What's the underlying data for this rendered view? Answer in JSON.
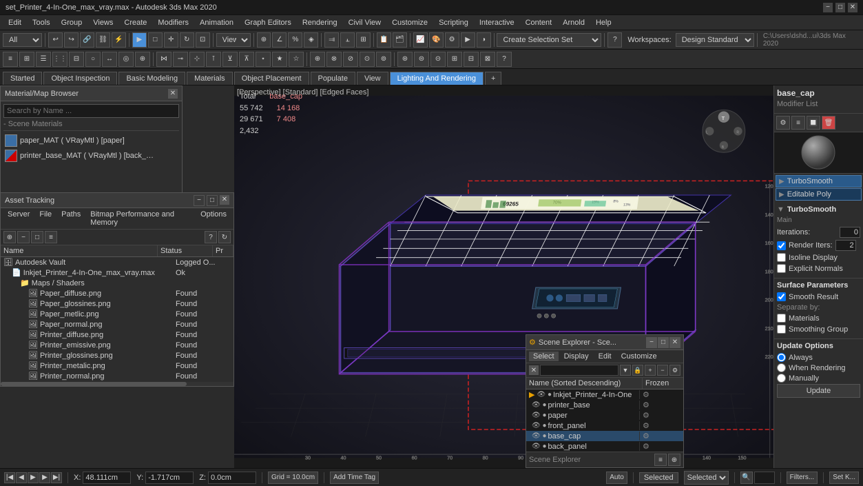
{
  "titlebar": {
    "title": "set_Printer_4-In-One_max_vray.max - Autodesk 3ds Max 2020",
    "min": "−",
    "max": "□",
    "close": "✕"
  },
  "menubar": {
    "items": [
      "Edit",
      "Tools",
      "Group",
      "Views",
      "Create",
      "Modifiers",
      "Animation",
      "Graph Editors",
      "Rendering",
      "Civil View",
      "Customize",
      "Scripting",
      "Interactive",
      "Content",
      "Arnold",
      "Help"
    ]
  },
  "toolbar": {
    "view_label": "All",
    "view_dropdown": "View",
    "workspace_label": "Workspaces:",
    "workspace_value": "Design Standard",
    "path": "C:\\Users\\dshd...ui\\3ds Max 2020"
  },
  "tabs": {
    "items": [
      "Started",
      "Object Inspection",
      "Basic Modeling",
      "Materials",
      "Object Placement",
      "Populate",
      "View",
      "Lighting And Rendering"
    ],
    "active": "Lighting And Rendering",
    "plus": "+"
  },
  "viewport": {
    "mode_label": "[Perspective] [Standard] [Edged Faces]",
    "stats": {
      "total_label": "Total",
      "total_obj": "base_cap",
      "v1": "55 742",
      "v2": "14 168",
      "v3": "29 671",
      "v4": "7 408",
      "v5": "2,432"
    }
  },
  "mat_browser": {
    "title": "Material/Map Browser",
    "search_placeholder": "Search by Name ...",
    "section_label": "Scene Materials",
    "items": [
      {
        "name": "paper_MAT (VRayMtl) [paper]",
        "type": "blue"
      },
      {
        "name": "printer_base_MAT (VRayMtl) [back_panel, ba...",
        "type": "blue-stripe"
      }
    ]
  },
  "asset_tracking": {
    "title": "Asset Tracking",
    "menu_items": [
      "Server",
      "File",
      "Paths",
      "Bitmap Performance and Memory",
      "Options"
    ],
    "columns": [
      "Name",
      "Status",
      "Pr"
    ],
    "rows": [
      {
        "indent": 0,
        "icon": "📁",
        "name": "Autodesk Vault",
        "status": "Logged O...",
        "pr": ""
      },
      {
        "indent": 1,
        "icon": "📄",
        "name": "Inkjet_Printer_4-In-One_max_vray.max",
        "status": "Ok",
        "pr": ""
      },
      {
        "indent": 2,
        "icon": "📁",
        "name": "Maps / Shaders",
        "status": "",
        "pr": ""
      },
      {
        "indent": 3,
        "icon": "🖼",
        "name": "Paper_diffuse.png",
        "status": "Found",
        "pr": ""
      },
      {
        "indent": 3,
        "icon": "🖼",
        "name": "Paper_glossines.png",
        "status": "Found",
        "pr": ""
      },
      {
        "indent": 3,
        "icon": "🖼",
        "name": "Paper_metlic.png",
        "status": "Found",
        "pr": ""
      },
      {
        "indent": 3,
        "icon": "🖼",
        "name": "Paper_normal.png",
        "status": "Found",
        "pr": ""
      },
      {
        "indent": 3,
        "icon": "🖼",
        "name": "Printer_diffuse.png",
        "status": "Found",
        "pr": ""
      },
      {
        "indent": 3,
        "icon": "🖼",
        "name": "Printer_emissive.png",
        "status": "Found",
        "pr": ""
      },
      {
        "indent": 3,
        "icon": "🖼",
        "name": "Printer_glossines.png",
        "status": "Found",
        "pr": ""
      },
      {
        "indent": 3,
        "icon": "🖼",
        "name": "Printer_metalic.png",
        "status": "Found",
        "pr": ""
      },
      {
        "indent": 3,
        "icon": "🖼",
        "name": "Printer_normal.png",
        "status": "Found",
        "pr": ""
      }
    ]
  },
  "right_panel": {
    "obj_name": "base_cap",
    "modifier_list_label": "Modifier List",
    "modifiers": [
      {
        "name": "TurboSmooth",
        "selected": true
      },
      {
        "name": "Editable Poly",
        "selected": false
      }
    ],
    "turbosmooth": {
      "title": "TurboSmooth",
      "subtitle": "Main",
      "iterations_label": "Iterations:",
      "iterations_value": "0",
      "render_iters_label": "Render Iters:",
      "render_iters_value": "2",
      "isoline_label": "Isoline Display",
      "explicit_normals_label": "Explicit Normals",
      "smooth_result_label": "Smooth Result",
      "surface_title": "Surface Parameters",
      "sep_label": "Separate by:",
      "materials_label": "Materials",
      "smoothing_label": "Smoothing Group",
      "update_title": "Update Options",
      "always_label": "Always",
      "when_rendering_label": "When Rendering",
      "manually_label": "Manually",
      "update_btn": "Update"
    }
  },
  "scene_explorer": {
    "title": "Scene Explorer - Sce...",
    "menu_items": [
      "Select",
      "Display",
      "Edit",
      "Customize"
    ],
    "col_name": "Name (Sorted Descending)",
    "col_frozen": "Frozen",
    "rows": [
      {
        "name": "Inkjet_Printer_4-In-One",
        "indent": 0,
        "selected": false
      },
      {
        "name": "printer_base",
        "indent": 1,
        "selected": false
      },
      {
        "name": "paper",
        "indent": 1,
        "selected": false
      },
      {
        "name": "front_panel",
        "indent": 1,
        "selected": false
      },
      {
        "name": "base_cap",
        "indent": 1,
        "selected": true
      },
      {
        "name": "back_panel",
        "indent": 1,
        "selected": false
      }
    ],
    "footer_label": "Scene Explorer"
  },
  "statusbar": {
    "x_label": "X:",
    "x_value": "48.111cm",
    "y_label": "Y:",
    "y_value": "-1.717cm",
    "z_label": "Z:",
    "z_value": "0.0cm",
    "grid_label": "Grid = 10.0cm",
    "auto_label": "Auto",
    "selected_label": "Selected",
    "filters_btn": "Filters...",
    "set_key_btn": "Set K..."
  }
}
